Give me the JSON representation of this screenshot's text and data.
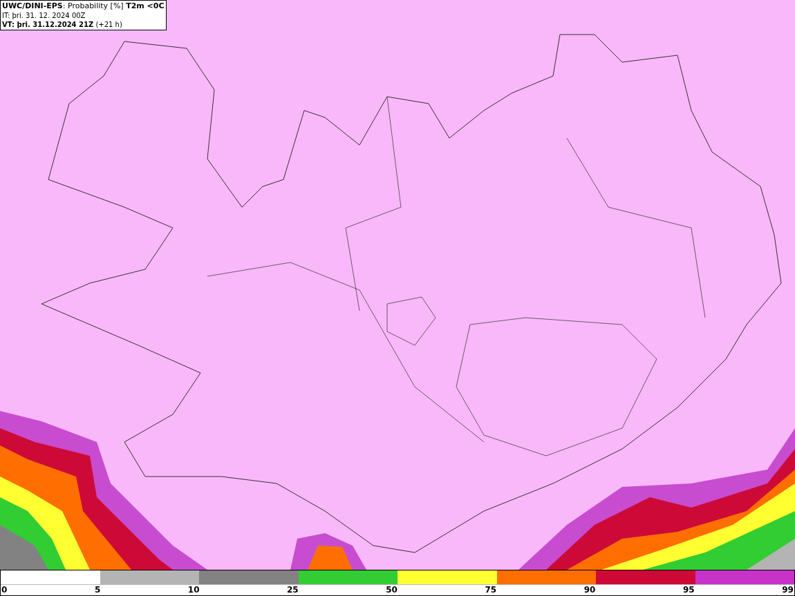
{
  "header": {
    "title": "**UWC/DINI-EPS**: Probability [%] **T2m <0C**",
    "issue_time": "IT: þri. 31. 12. 2024 00Z",
    "valid_time": "**VT: þri. 31.12.2024 21Z** (+21 h)"
  },
  "legend": {
    "segments": [
      {
        "color": "#ffffff"
      },
      {
        "color": "#b4b4b4"
      },
      {
        "color": "#828282"
      },
      {
        "color": "#32cd32"
      },
      {
        "color": "#ffff32"
      },
      {
        "color": "#ff6e00"
      },
      {
        "color": "#cd0a37"
      },
      {
        "color": "#c832c8"
      }
    ],
    "ticks": [
      "0",
      "5",
      "10",
      "25",
      "50",
      "75",
      "90",
      "95",
      "99"
    ]
  }
}
